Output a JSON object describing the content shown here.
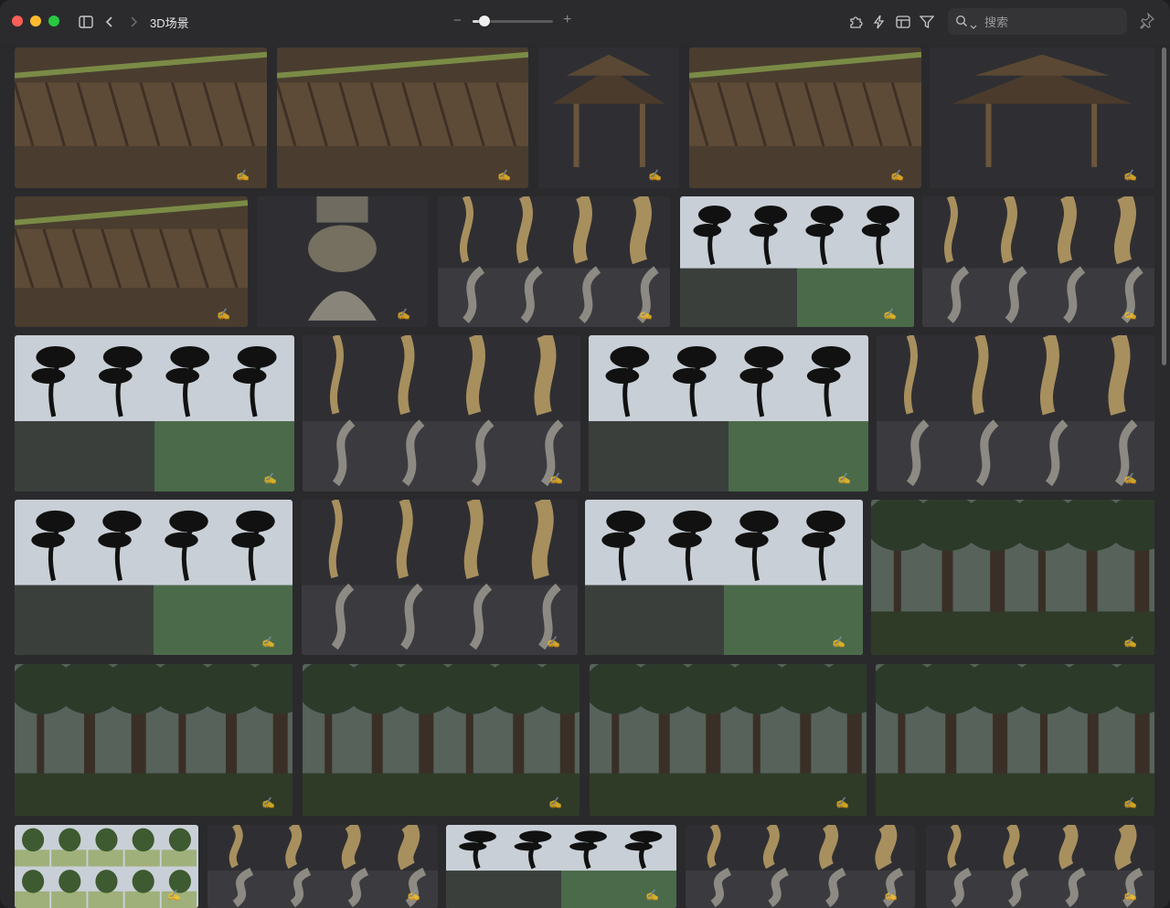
{
  "window": {
    "title": "3D场景",
    "colors": {
      "background": "#2a2a2d",
      "toolbar": "#2b2b2e",
      "close": "#fe5f57",
      "minimize": "#febc2e",
      "maximize": "#28c840"
    }
  },
  "toolbar": {
    "icons": [
      "sidebar-icon",
      "chevron-left-icon",
      "chevron-right-icon",
      "extension-icon",
      "flash-icon",
      "layout-icon",
      "filter-icon",
      "pin-icon"
    ],
    "zoom": {
      "minus": "−",
      "plus": "+",
      "level": 0.15
    }
  },
  "search": {
    "placeholder": "搜索",
    "value": ""
  },
  "gallery": {
    "items": [
      {
        "kind": "bridge"
      },
      {
        "kind": "bridge"
      },
      {
        "kind": "pavilion"
      },
      {
        "kind": "carving"
      },
      {
        "kind": "pavilion"
      },
      {
        "kind": "roof"
      },
      {
        "kind": "column"
      },
      {
        "kind": "deadtree"
      },
      {
        "kind": "pinesilhouette"
      },
      {
        "kind": "deadtree"
      },
      {
        "kind": "pinesilhouette"
      },
      {
        "kind": "deadtree"
      },
      {
        "kind": "pinesilhouette"
      },
      {
        "kind": "deadtree"
      },
      {
        "kind": "pinesilhouette"
      },
      {
        "kind": "branch"
      },
      {
        "kind": "pinesilhouette"
      },
      {
        "kind": "forest"
      },
      {
        "kind": "forest"
      },
      {
        "kind": "forest"
      },
      {
        "kind": "forest"
      },
      {
        "kind": "forest"
      },
      {
        "kind": "treesgrid"
      },
      {
        "kind": "deadtree"
      },
      {
        "kind": "pinesilhouette"
      },
      {
        "kind": "deadtree"
      },
      {
        "kind": "deadtree"
      }
    ]
  }
}
